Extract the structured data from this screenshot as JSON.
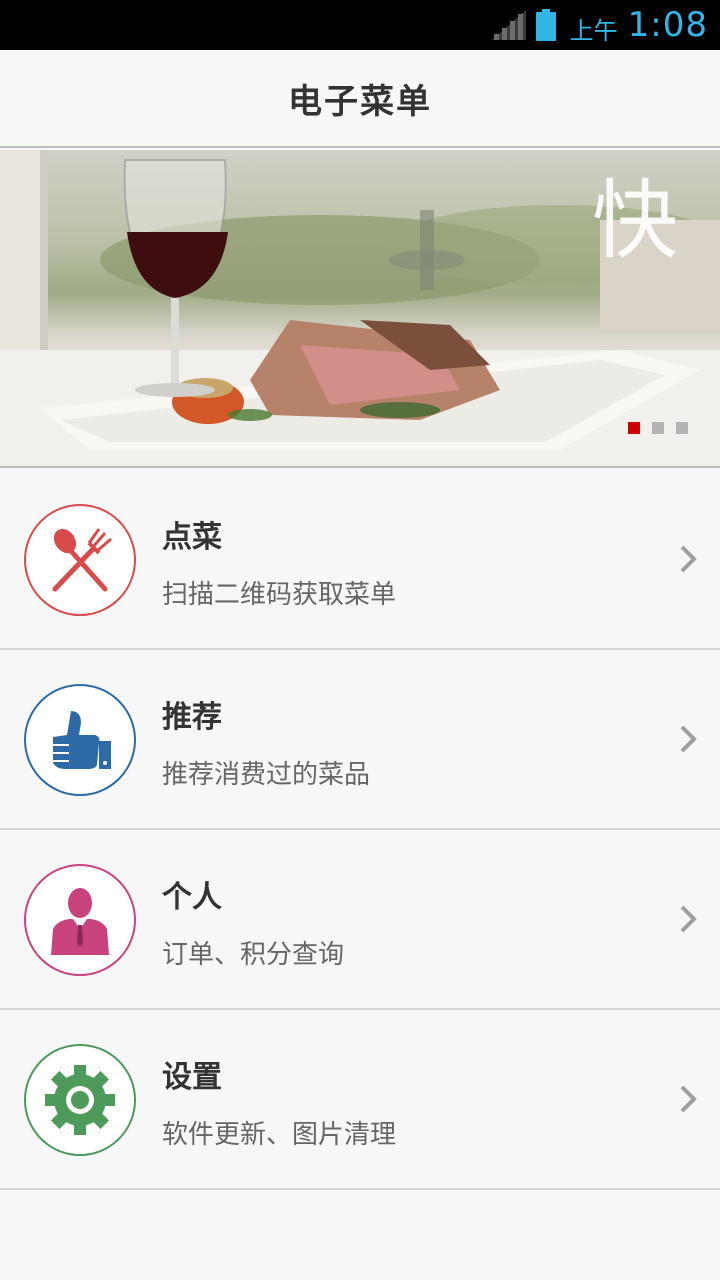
{
  "status_bar": {
    "ampm": "上午",
    "time": "1:08",
    "accent_color": "#33b5e5"
  },
  "header": {
    "title": "电子菜单"
  },
  "banner": {
    "calligraphy": "快",
    "active_dot_color": "#cc0000",
    "inactive_dot_color": "#b3b3b3"
  },
  "menu": [
    {
      "title": "点菜",
      "subtitle": "扫描二维码获取菜单",
      "icon": "utensils-icon",
      "color": "#d94a4a"
    },
    {
      "title": "推荐",
      "subtitle": "推荐消费过的菜品",
      "icon": "thumbs-up-icon",
      "color": "#2e6aa6"
    },
    {
      "title": "个人",
      "subtitle": "订单、积分查询",
      "icon": "person-icon",
      "color": "#c8437e"
    },
    {
      "title": "设置",
      "subtitle": "软件更新、图片清理",
      "icon": "gear-icon",
      "color": "#4e9a5a"
    }
  ]
}
